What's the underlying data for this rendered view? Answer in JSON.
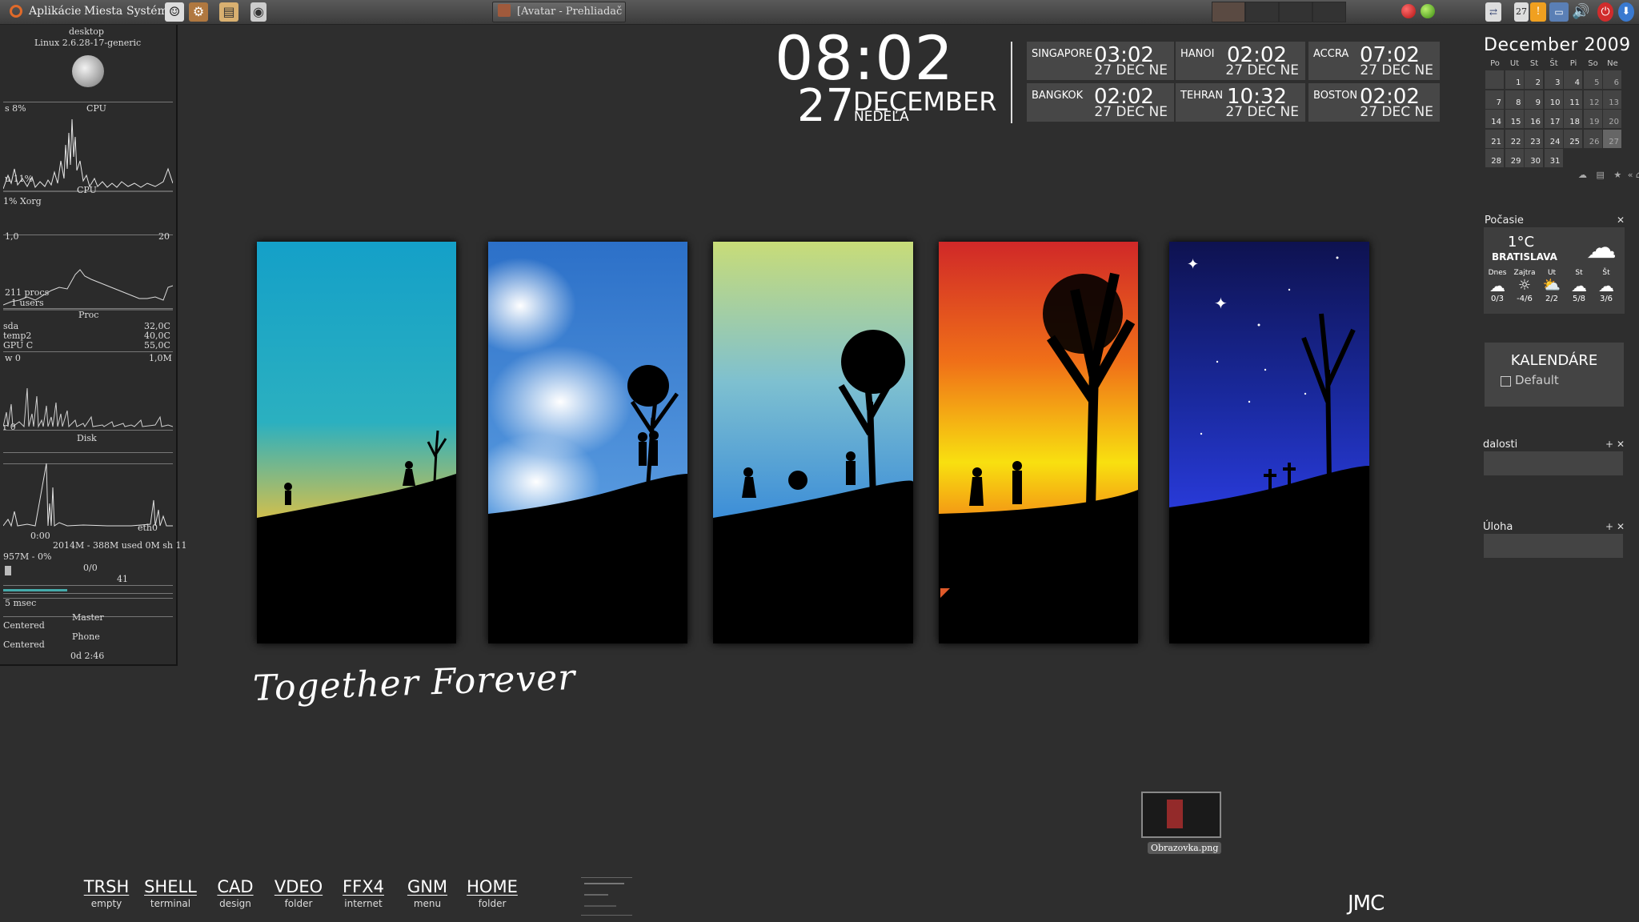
{
  "top_panel": {
    "menus": [
      "Aplikácie",
      "Miesta",
      "Systém"
    ],
    "task_title": "[Avatar - Prehliadač s...",
    "tray_date": "27"
  },
  "conky": {
    "hostname": "desktop",
    "kernel": "Linux 2.6.28-17-generic",
    "cpu_label": "CPU",
    "cpu_top": "s  8%",
    "cpu_bottom": "u 11%",
    "cpu_label2": "CPU",
    "top_proc": "1% Xorg",
    "scale_left": "1,0",
    "scale_right": "20",
    "procs": "211 procs",
    "users": "1 users",
    "proc_label": "Proc",
    "sensors": [
      {
        "name": "sda",
        "value": "32,0C"
      },
      {
        "name": "temp2",
        "value": "40,0C"
      },
      {
        "name": "GPU C",
        "value": "55,0C"
      }
    ],
    "disk_w": "w 0",
    "disk_max": "1,0M",
    "disk_r": "r 0",
    "disk_label": "Disk",
    "net_time": "0:00",
    "net_if": "eth0",
    "mem": "2014M - 388M used  0M sh  11",
    "swap": "957M - 0%",
    "ratio": "0/0",
    "count": "41",
    "ping": "5 msec",
    "audio_left_1": "Centered",
    "audio_right_1": "Master",
    "audio_left_2": "Centered",
    "audio_right_2": "Phone",
    "uptime": "0d  2:46"
  },
  "clock": {
    "time": "08:02",
    "day": "27",
    "month": "DECEMBER",
    "weekday": "NEDEĽA"
  },
  "world_clocks": [
    {
      "city": "SINGAPORE",
      "time": "03:02",
      "date": "27 DEC  NE"
    },
    {
      "city": "HANOI",
      "time": "02:02",
      "date": "27 DEC  NE"
    },
    {
      "city": "ACCRA",
      "time": "07:02",
      "date": "27 DEC  NE"
    },
    {
      "city": "BANGKOK",
      "time": "02:02",
      "date": "27 DEC  NE"
    },
    {
      "city": "TEHRAN",
      "time": "10:32",
      "date": "27 DEC  NE"
    },
    {
      "city": "BOSTON",
      "time": "02:02",
      "date": "27 DEC  NE"
    }
  ],
  "calendar": {
    "title": "December  2009",
    "day_headers": [
      "Po",
      "Ut",
      "St",
      "Št",
      "Pi",
      "So",
      "Ne"
    ],
    "days": [
      "1",
      "2",
      "3",
      "4",
      "5",
      "6",
      "7",
      "8",
      "9",
      "10",
      "11",
      "12",
      "13",
      "14",
      "15",
      "16",
      "17",
      "18",
      "19",
      "20",
      "21",
      "22",
      "23",
      "24",
      "25",
      "26",
      "27",
      "28",
      "29",
      "30",
      "31"
    ],
    "today": "27"
  },
  "weather": {
    "title": "Počasie",
    "temp": "1°C",
    "city": "BRATISLAVA",
    "days": [
      {
        "name": "Dnes",
        "range": "0/3"
      },
      {
        "name": "Zajtra",
        "range": "-4/6"
      },
      {
        "name": "Ut",
        "range": "2/2"
      },
      {
        "name": "St",
        "range": "5/8"
      },
      {
        "name": "Št",
        "range": "3/6"
      }
    ]
  },
  "kalendare": {
    "title": "KALENDÁRE",
    "item": "Default"
  },
  "udalosti": {
    "title": "dalosti"
  },
  "ulohy": {
    "title": "Úloha"
  },
  "wallpaper": {
    "motto": "Together Forever"
  },
  "launcher": [
    {
      "name": "TRSH",
      "sub": "empty"
    },
    {
      "name": "SHELL",
      "sub": "terminal"
    },
    {
      "name": "CAD",
      "sub": "design"
    },
    {
      "name": "VDEO",
      "sub": "folder"
    },
    {
      "name": "FFX4",
      "sub": "internet"
    },
    {
      "name": "GNM",
      "sub": "menu"
    },
    {
      "name": "HOME",
      "sub": "folder"
    }
  ],
  "desktop_file": {
    "label": "Obrazovka.png"
  },
  "signature": "JMC",
  "colors": {
    "accent_red": "#c83232",
    "panel_bg": "#474747",
    "desktop_bg": "#2e2e2e"
  }
}
